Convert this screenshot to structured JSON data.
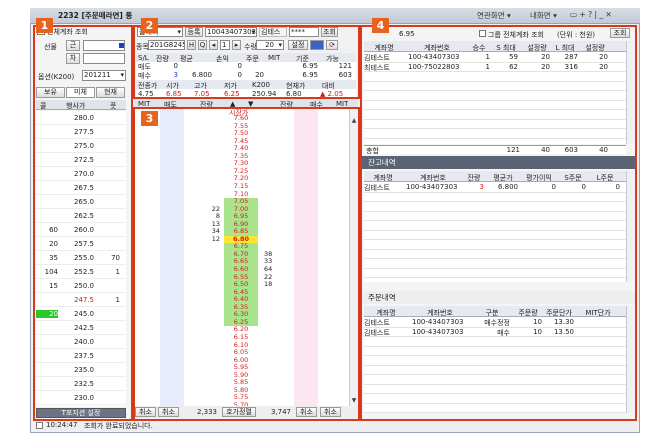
{
  "window": {
    "title": "2232 [주문매라면] 통",
    "menu_linked": "연관화면 ▾",
    "menu_help": "내화면 ▾",
    "ctrl_icons": "▭ + ? | _ ✕"
  },
  "badges": [
    "1",
    "2",
    "3",
    "4"
  ],
  "panel1": {
    "account_check": "전체계좌 조회",
    "futures_label": "선물",
    "btn_near": "근",
    "btn_far": "차",
    "option_label": "옵션(K200)",
    "option_value": "201211",
    "tab_hold": "보유",
    "tab_unfilled": "미체",
    "tab_current": "현재",
    "col_strike": "행사가",
    "col_close": "콜",
    "col_pos": "풋",
    "rows": [
      {
        "c": "",
        "k": "280.0",
        "p": ""
      },
      {
        "c": "",
        "k": "277.5",
        "p": ""
      },
      {
        "c": "",
        "k": "275.0",
        "p": ""
      },
      {
        "c": "",
        "k": "272.5",
        "p": ""
      },
      {
        "c": "",
        "k": "270.0",
        "p": ""
      },
      {
        "c": "",
        "k": "267.5",
        "p": ""
      },
      {
        "c": "",
        "k": "265.0",
        "p": ""
      },
      {
        "c": "",
        "k": "262.5",
        "p": ""
      },
      {
        "c": "60",
        "k": "260.0",
        "p": ""
      },
      {
        "c": "20",
        "k": "257.5",
        "p": ""
      },
      {
        "c": "35",
        "k": "255.0",
        "p": "70"
      },
      {
        "c": "104",
        "k": "252.5",
        "p": "1"
      },
      {
        "c": "15",
        "k": "250.0",
        "p": ""
      },
      {
        "c": "",
        "k": "247.5",
        "p": "1"
      },
      {
        "c": "20",
        "k": "245.0",
        "p": ""
      },
      {
        "c": "",
        "k": "242.5",
        "p": ""
      },
      {
        "c": "",
        "k": "240.0",
        "p": ""
      },
      {
        "c": "",
        "k": "237.5",
        "p": ""
      },
      {
        "c": "",
        "k": "235.0",
        "p": ""
      },
      {
        "c": "",
        "k": "232.5",
        "p": ""
      },
      {
        "c": "",
        "k": "230.0",
        "p": ""
      }
    ],
    "bottom_btn": "T포지션 설정"
  },
  "panel2": {
    "type_select": "옵대리",
    "btn_register": "등록",
    "account": "10043407303",
    "acct_name": "김테스",
    "password": "****",
    "btn_query": "조회",
    "code_label": "종목",
    "code": "201G8245",
    "qty_label": "수량",
    "qty": "20",
    "unit": "1",
    "btn_setting": "설정",
    "pos_headers": [
      "S/L",
      "잔량",
      "평균",
      "손익",
      "주문",
      "MIT",
      "기준",
      "가능"
    ],
    "pos_rows": [
      [
        "매도",
        "0",
        "",
        "0",
        "",
        "",
        "6.95",
        "121"
      ],
      [
        "매수",
        "3",
        "6.800",
        "0",
        "20",
        "",
        "6.95",
        "603"
      ]
    ],
    "quote_headers": [
      "전종가",
      "시가",
      "고가",
      "저가",
      "K200",
      "현재가",
      "대비"
    ],
    "quote_values": [
      "4.75",
      "6.85",
      "7.05",
      "6.25",
      "250.94",
      "6.80",
      "▲ 2.05"
    ]
  },
  "panel3": {
    "headers": [
      "MIT",
      "매도",
      "잔량",
      "▲",
      "▼",
      "잔량",
      "매수",
      "MIT"
    ],
    "top_label": "시장가",
    "prices": [
      "7.60",
      "7.55",
      "7.50",
      "7.45",
      "7.40",
      "7.35",
      "7.30",
      "7.25",
      "7.20",
      "7.15",
      "7.10",
      "7.05",
      "7.00",
      "6.95",
      "6.90",
      "6.85",
      "6.80",
      "6.75",
      "6.70",
      "6.65",
      "6.60",
      "6.55",
      "6.50",
      "6.45",
      "6.40",
      "6.35",
      "6.30",
      "6.25",
      "6.20",
      "6.15",
      "6.10",
      "6.05",
      "6.00",
      "5.95",
      "5.90",
      "5.85",
      "5.80",
      "5.75",
      "5.70"
    ],
    "sell_qty": {
      "7.00": "22",
      "6.95": "8",
      "6.90": "13",
      "6.85": "34",
      "6.80": "12"
    },
    "buy_qty": {
      "6.70": "38",
      "6.65": "33",
      "6.60": "64",
      "6.55": "22",
      "6.50": "18"
    },
    "bottom": {
      "cancel1": "취소",
      "cancel2": "취소",
      "sell_total": "2,333",
      "center": "호가정렬",
      "buy_total": "3,747",
      "cancel3": "취소",
      "cancel4": "취소"
    }
  },
  "panel4": {
    "price": "6.95",
    "group_check": "그룹 전체계좌 조회",
    "unit_note": "(단위 : 천원)",
    "btn_query": "조회",
    "top_headers": [
      "계좌명",
      "계좌번호",
      "승수",
      "S 최대",
      "설정량",
      "L 최대",
      "설정량"
    ],
    "top_rows": [
      [
        "김테스트",
        "100-43407303",
        "1",
        "59",
        "20",
        "287",
        "20"
      ],
      [
        "최테스트",
        "100-75022803",
        "1",
        "62",
        "20",
        "316",
        "20"
      ]
    ],
    "total_label": "총합",
    "total_vals": [
      "121",
      "40",
      "603",
      "40"
    ],
    "balance_title": "잔고내역",
    "bal_headers": [
      "계좌명",
      "계좌번호",
      "잔량",
      "평균가",
      "평가이익",
      "S주문",
      "L주문"
    ],
    "bal_rows": [
      [
        "김테스트",
        "100-43407303",
        "3",
        "6.800",
        "0",
        "0",
        "0"
      ]
    ],
    "order_title": "주문내역",
    "ord_headers": [
      "계좌명",
      "계좌번호",
      "구분",
      "주문량",
      "주문단가",
      "MIT단가"
    ],
    "ord_rows": [
      [
        "김테스트",
        "100-43407303",
        "매수정정",
        "10",
        "13.30",
        ""
      ],
      [
        "김테스트",
        "100-43407303",
        "매수",
        "10",
        "13.50",
        ""
      ]
    ]
  },
  "status": {
    "time": "10:24:47",
    "message": "조회가 완료되었습니다."
  }
}
